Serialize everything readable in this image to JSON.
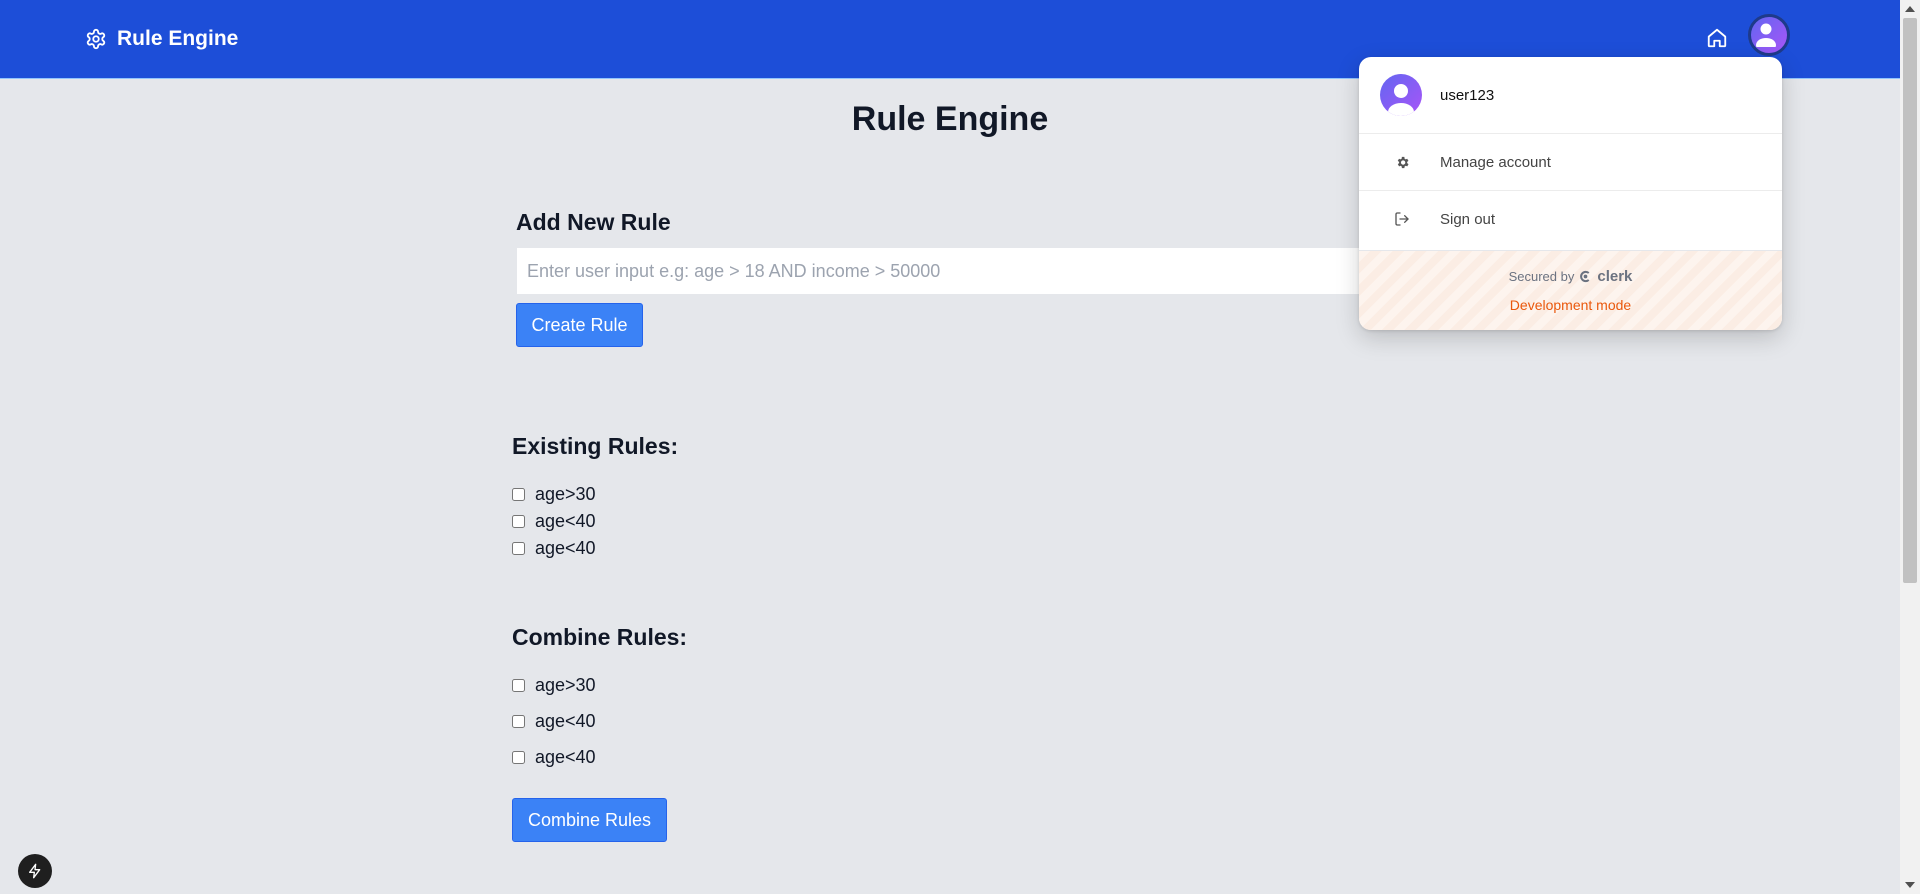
{
  "navbar": {
    "brand": "Rule Engine"
  },
  "page": {
    "title": "Rule Engine"
  },
  "add_rule": {
    "heading": "Add New Rule",
    "input_placeholder": "Enter user input e.g: age > 18 AND income > 50000",
    "input_value": "",
    "button": "Create Rule"
  },
  "existing_rules": {
    "heading": "Existing Rules:",
    "items": [
      "age>30",
      "age<40",
      "age<40"
    ]
  },
  "combine_rules": {
    "heading": "Combine Rules:",
    "items": [
      "age>30",
      "age<40",
      "age<40"
    ],
    "button": "Combine Rules"
  },
  "user_menu": {
    "username": "user123",
    "items": [
      "Manage account",
      "Sign out"
    ],
    "secured_by": "Secured by",
    "brand": "clerk",
    "mode": "Development mode"
  },
  "colors": {
    "navbar": "#1d4ed8",
    "button": "#3b82f6",
    "background": "#e5e7eb",
    "dev_mode": "#ea580c"
  }
}
